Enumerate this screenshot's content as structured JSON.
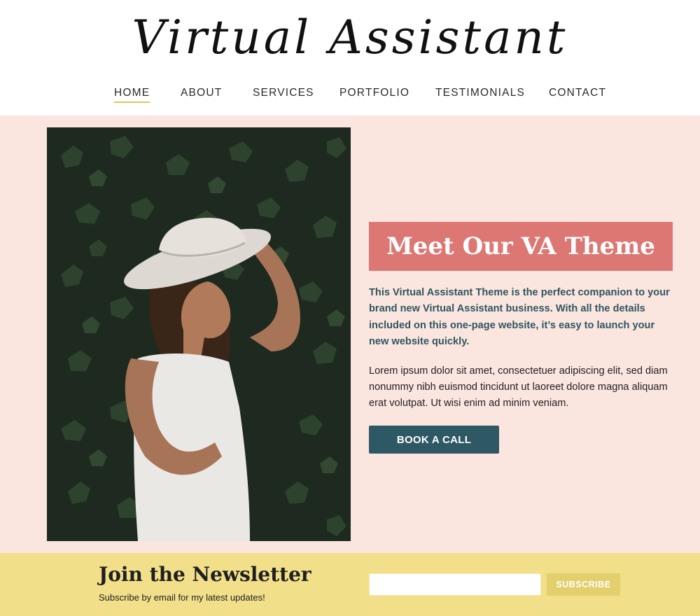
{
  "header": {
    "logo_text": "Virtual Assistant",
    "nav": [
      {
        "label": "HOME",
        "active": true
      },
      {
        "label": "ABOUT",
        "active": false
      },
      {
        "label": "SERVICES",
        "active": false
      },
      {
        "label": "PORTFOLIO",
        "active": false
      },
      {
        "label": "TESTIMONIALS",
        "active": false
      },
      {
        "label": "CONTACT",
        "active": false
      }
    ],
    "accent_color": "#e3c35a"
  },
  "hero": {
    "background_color": "#fbe5df",
    "image_subject": "woman in white wide-brim hat and white sundress in front of ivy wall",
    "headline": "Meet Our VA Theme",
    "headline_bg": "#dd7774",
    "intro": "This Virtual Assistant Theme is the perfect companion to your brand new Virtual Assistant business. With all the details included on this one-page website, it’s easy to launch your new website quickly.",
    "body": "Lorem ipsum dolor sit amet, consectetuer adipiscing elit, sed diam nonummy nibh euismod tincidunt ut laoreet dolore magna aliquam erat volutpat. Ut wisi enim ad minim veniam.",
    "cta_label": "BOOK A CALL",
    "cta_color": "#2e5964"
  },
  "newsletter": {
    "background_color": "#f1df8a",
    "title": "Join the Newsletter",
    "subtitle": "Subscribe by email for my latest updates!",
    "email_placeholder": "",
    "button_label": "SUBSCRIBE",
    "button_color": "#e3cf6b"
  }
}
